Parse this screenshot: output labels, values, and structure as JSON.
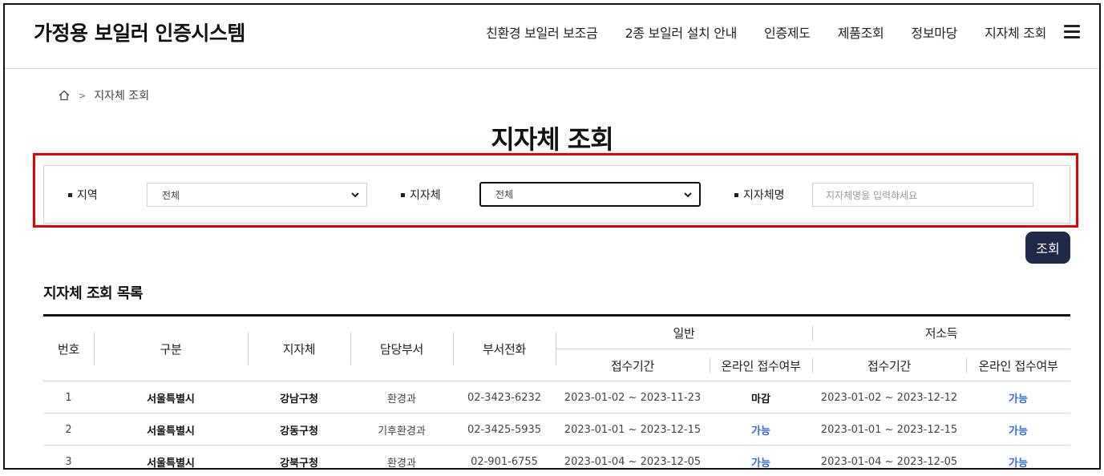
{
  "header": {
    "logo": "가정용 보일러 인증시스템",
    "nav": [
      "친환경 보일러 보조금",
      "2종 보일러 설치 안내",
      "인증제도",
      "제품조회",
      "정보마당",
      "지자체 조회"
    ]
  },
  "breadcrumb": {
    "current": "지자체 조회"
  },
  "page_title": "지자체 조회",
  "search": {
    "region_label": "지역",
    "region_value": "전체",
    "municipality_label": "지자체",
    "municipality_value": "전체",
    "name_label": "지자체명",
    "name_placeholder": "지자체명을 입력하세요",
    "button": "조회"
  },
  "list_title": "지자체 조회 목록",
  "table": {
    "headers": {
      "no": "번호",
      "category": "구분",
      "municipality": "지자체",
      "department": "담당부서",
      "phone": "부서전화",
      "general": "일반",
      "low_income": "저소득",
      "period": "접수기간",
      "online": "온라인 접수여부"
    },
    "rows": [
      {
        "no": "1",
        "category": "서울특별시",
        "municipality": "강남구청",
        "department": "환경과",
        "phone": "02-3423-6232",
        "general_period": "2023-01-02 ~ 2023-11-23",
        "general_online": "마감",
        "low_period": "2023-01-02 ~ 2023-12-12",
        "low_online": "가능"
      },
      {
        "no": "2",
        "category": "서울특별시",
        "municipality": "강동구청",
        "department": "기후환경과",
        "phone": "02-3425-5935",
        "general_period": "2023-01-01 ~ 2023-12-15",
        "general_online": "가능",
        "low_period": "2023-01-01 ~ 2023-12-15",
        "low_online": "가능"
      },
      {
        "no": "3",
        "category": "서울특별시",
        "municipality": "강북구청",
        "department": "환경과",
        "phone": "02-901-6755",
        "general_period": "2023-01-04 ~ 2023-12-05",
        "general_online": "가능",
        "low_period": "2023-01-04 ~ 2023-12-05",
        "low_online": "가능"
      }
    ]
  },
  "colors": {
    "accent_navy": "#1f2a4a",
    "highlight_red": "#e60000",
    "available_blue": "#2f6fd6"
  },
  "icons": [
    "home-icon",
    "chevron-down-icon",
    "hamburger-menu-icon"
  ]
}
